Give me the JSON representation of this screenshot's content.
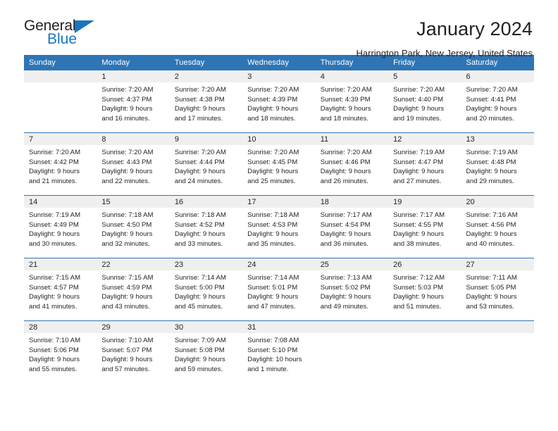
{
  "brand": {
    "name_top": "General",
    "name_bottom": "Blue",
    "accent_color": "#1c75bc",
    "triangle_icon": "triangle-icon"
  },
  "header": {
    "title": "January 2024",
    "subtitle": "Harrington Park, New Jersey, United States",
    "header_bg": "#2e75b6",
    "header_text": "#ffffff",
    "daynum_bg": "#efefef"
  },
  "weekday_headers": [
    "Sunday",
    "Monday",
    "Tuesday",
    "Wednesday",
    "Thursday",
    "Friday",
    "Saturday"
  ],
  "labels": {
    "sunrise_prefix": "Sunrise:",
    "sunset_prefix": "Sunset:",
    "daylight_prefix": "Daylight:"
  },
  "weeks": [
    [
      {
        "day": "",
        "empty": true,
        "line1": "",
        "line2": "",
        "line3": "",
        "line4": ""
      },
      {
        "day": "1",
        "line1": "Sunrise: 7:20 AM",
        "line2": "Sunset: 4:37 PM",
        "line3": "Daylight: 9 hours",
        "line4": "and 16 minutes."
      },
      {
        "day": "2",
        "line1": "Sunrise: 7:20 AM",
        "line2": "Sunset: 4:38 PM",
        "line3": "Daylight: 9 hours",
        "line4": "and 17 minutes."
      },
      {
        "day": "3",
        "line1": "Sunrise: 7:20 AM",
        "line2": "Sunset: 4:39 PM",
        "line3": "Daylight: 9 hours",
        "line4": "and 18 minutes."
      },
      {
        "day": "4",
        "line1": "Sunrise: 7:20 AM",
        "line2": "Sunset: 4:39 PM",
        "line3": "Daylight: 9 hours",
        "line4": "and 18 minutes."
      },
      {
        "day": "5",
        "line1": "Sunrise: 7:20 AM",
        "line2": "Sunset: 4:40 PM",
        "line3": "Daylight: 9 hours",
        "line4": "and 19 minutes."
      },
      {
        "day": "6",
        "line1": "Sunrise: 7:20 AM",
        "line2": "Sunset: 4:41 PM",
        "line3": "Daylight: 9 hours",
        "line4": "and 20 minutes."
      }
    ],
    [
      {
        "day": "7",
        "line1": "Sunrise: 7:20 AM",
        "line2": "Sunset: 4:42 PM",
        "line3": "Daylight: 9 hours",
        "line4": "and 21 minutes."
      },
      {
        "day": "8",
        "line1": "Sunrise: 7:20 AM",
        "line2": "Sunset: 4:43 PM",
        "line3": "Daylight: 9 hours",
        "line4": "and 22 minutes."
      },
      {
        "day": "9",
        "line1": "Sunrise: 7:20 AM",
        "line2": "Sunset: 4:44 PM",
        "line3": "Daylight: 9 hours",
        "line4": "and 24 minutes."
      },
      {
        "day": "10",
        "line1": "Sunrise: 7:20 AM",
        "line2": "Sunset: 4:45 PM",
        "line3": "Daylight: 9 hours",
        "line4": "and 25 minutes."
      },
      {
        "day": "11",
        "line1": "Sunrise: 7:20 AM",
        "line2": "Sunset: 4:46 PM",
        "line3": "Daylight: 9 hours",
        "line4": "and 26 minutes."
      },
      {
        "day": "12",
        "line1": "Sunrise: 7:19 AM",
        "line2": "Sunset: 4:47 PM",
        "line3": "Daylight: 9 hours",
        "line4": "and 27 minutes."
      },
      {
        "day": "13",
        "line1": "Sunrise: 7:19 AM",
        "line2": "Sunset: 4:48 PM",
        "line3": "Daylight: 9 hours",
        "line4": "and 29 minutes."
      }
    ],
    [
      {
        "day": "14",
        "line1": "Sunrise: 7:19 AM",
        "line2": "Sunset: 4:49 PM",
        "line3": "Daylight: 9 hours",
        "line4": "and 30 minutes."
      },
      {
        "day": "15",
        "line1": "Sunrise: 7:18 AM",
        "line2": "Sunset: 4:50 PM",
        "line3": "Daylight: 9 hours",
        "line4": "and 32 minutes."
      },
      {
        "day": "16",
        "line1": "Sunrise: 7:18 AM",
        "line2": "Sunset: 4:52 PM",
        "line3": "Daylight: 9 hours",
        "line4": "and 33 minutes."
      },
      {
        "day": "17",
        "line1": "Sunrise: 7:18 AM",
        "line2": "Sunset: 4:53 PM",
        "line3": "Daylight: 9 hours",
        "line4": "and 35 minutes."
      },
      {
        "day": "18",
        "line1": "Sunrise: 7:17 AM",
        "line2": "Sunset: 4:54 PM",
        "line3": "Daylight: 9 hours",
        "line4": "and 36 minutes."
      },
      {
        "day": "19",
        "line1": "Sunrise: 7:17 AM",
        "line2": "Sunset: 4:55 PM",
        "line3": "Daylight: 9 hours",
        "line4": "and 38 minutes."
      },
      {
        "day": "20",
        "line1": "Sunrise: 7:16 AM",
        "line2": "Sunset: 4:56 PM",
        "line3": "Daylight: 9 hours",
        "line4": "and 40 minutes."
      }
    ],
    [
      {
        "day": "21",
        "line1": "Sunrise: 7:15 AM",
        "line2": "Sunset: 4:57 PM",
        "line3": "Daylight: 9 hours",
        "line4": "and 41 minutes."
      },
      {
        "day": "22",
        "line1": "Sunrise: 7:15 AM",
        "line2": "Sunset: 4:59 PM",
        "line3": "Daylight: 9 hours",
        "line4": "and 43 minutes."
      },
      {
        "day": "23",
        "line1": "Sunrise: 7:14 AM",
        "line2": "Sunset: 5:00 PM",
        "line3": "Daylight: 9 hours",
        "line4": "and 45 minutes."
      },
      {
        "day": "24",
        "line1": "Sunrise: 7:14 AM",
        "line2": "Sunset: 5:01 PM",
        "line3": "Daylight: 9 hours",
        "line4": "and 47 minutes."
      },
      {
        "day": "25",
        "line1": "Sunrise: 7:13 AM",
        "line2": "Sunset: 5:02 PM",
        "line3": "Daylight: 9 hours",
        "line4": "and 49 minutes."
      },
      {
        "day": "26",
        "line1": "Sunrise: 7:12 AM",
        "line2": "Sunset: 5:03 PM",
        "line3": "Daylight: 9 hours",
        "line4": "and 51 minutes."
      },
      {
        "day": "27",
        "line1": "Sunrise: 7:11 AM",
        "line2": "Sunset: 5:05 PM",
        "line3": "Daylight: 9 hours",
        "line4": "and 53 minutes."
      }
    ],
    [
      {
        "day": "28",
        "line1": "Sunrise: 7:10 AM",
        "line2": "Sunset: 5:06 PM",
        "line3": "Daylight: 9 hours",
        "line4": "and 55 minutes."
      },
      {
        "day": "29",
        "line1": "Sunrise: 7:10 AM",
        "line2": "Sunset: 5:07 PM",
        "line3": "Daylight: 9 hours",
        "line4": "and 57 minutes."
      },
      {
        "day": "30",
        "line1": "Sunrise: 7:09 AM",
        "line2": "Sunset: 5:08 PM",
        "line3": "Daylight: 9 hours",
        "line4": "and 59 minutes."
      },
      {
        "day": "31",
        "line1": "Sunrise: 7:08 AM",
        "line2": "Sunset: 5:10 PM",
        "line3": "Daylight: 10 hours",
        "line4": "and 1 minute."
      },
      {
        "day": "",
        "empty": true,
        "line1": "",
        "line2": "",
        "line3": "",
        "line4": ""
      },
      {
        "day": "",
        "empty": true,
        "line1": "",
        "line2": "",
        "line3": "",
        "line4": ""
      },
      {
        "day": "",
        "empty": true,
        "line1": "",
        "line2": "",
        "line3": "",
        "line4": ""
      }
    ]
  ]
}
